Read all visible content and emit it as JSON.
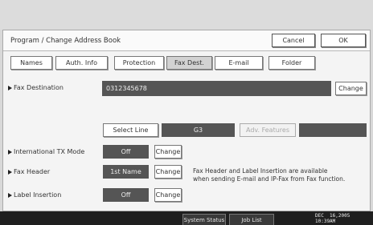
{
  "header": {
    "title": "Program / Change Address Book",
    "cancel_label": "Cancel",
    "ok_label": "OK"
  },
  "tabs": [
    {
      "label": "Names"
    },
    {
      "label": "Auth. Info"
    },
    {
      "label": "Protection"
    },
    {
      "label": "Fax Dest.",
      "active": true
    },
    {
      "label": "E-mail"
    },
    {
      "label": "Folder"
    }
  ],
  "fax_destination": {
    "label": "Fax Destination",
    "value": "0312345678",
    "change_label": "Change"
  },
  "line_row": {
    "select_line_label": "Select Line",
    "line_value": "G3",
    "adv_features_label": "Adv. Features"
  },
  "international_tx": {
    "label": "International TX Mode",
    "value": "Off",
    "change_label": "Change"
  },
  "fax_header": {
    "label": "Fax Header",
    "value": "1st Name",
    "change_label": "Change",
    "info_line1": "Fax Header and Label Insertion are available",
    "info_line2": "when sending E-mail and IP-Fax from Fax function."
  },
  "label_insertion": {
    "label": "Label Insertion",
    "value": "Off",
    "change_label": "Change"
  },
  "bottom_bar": {
    "system_status_label": "System Status",
    "job_list_label": "Job List",
    "date": "DEC  16,2005",
    "time": "10:39AM"
  },
  "colors": {
    "dark_field": "#555555",
    "active_tab": "#d2d2d2",
    "bottom_bar": "#1f1f1f"
  }
}
